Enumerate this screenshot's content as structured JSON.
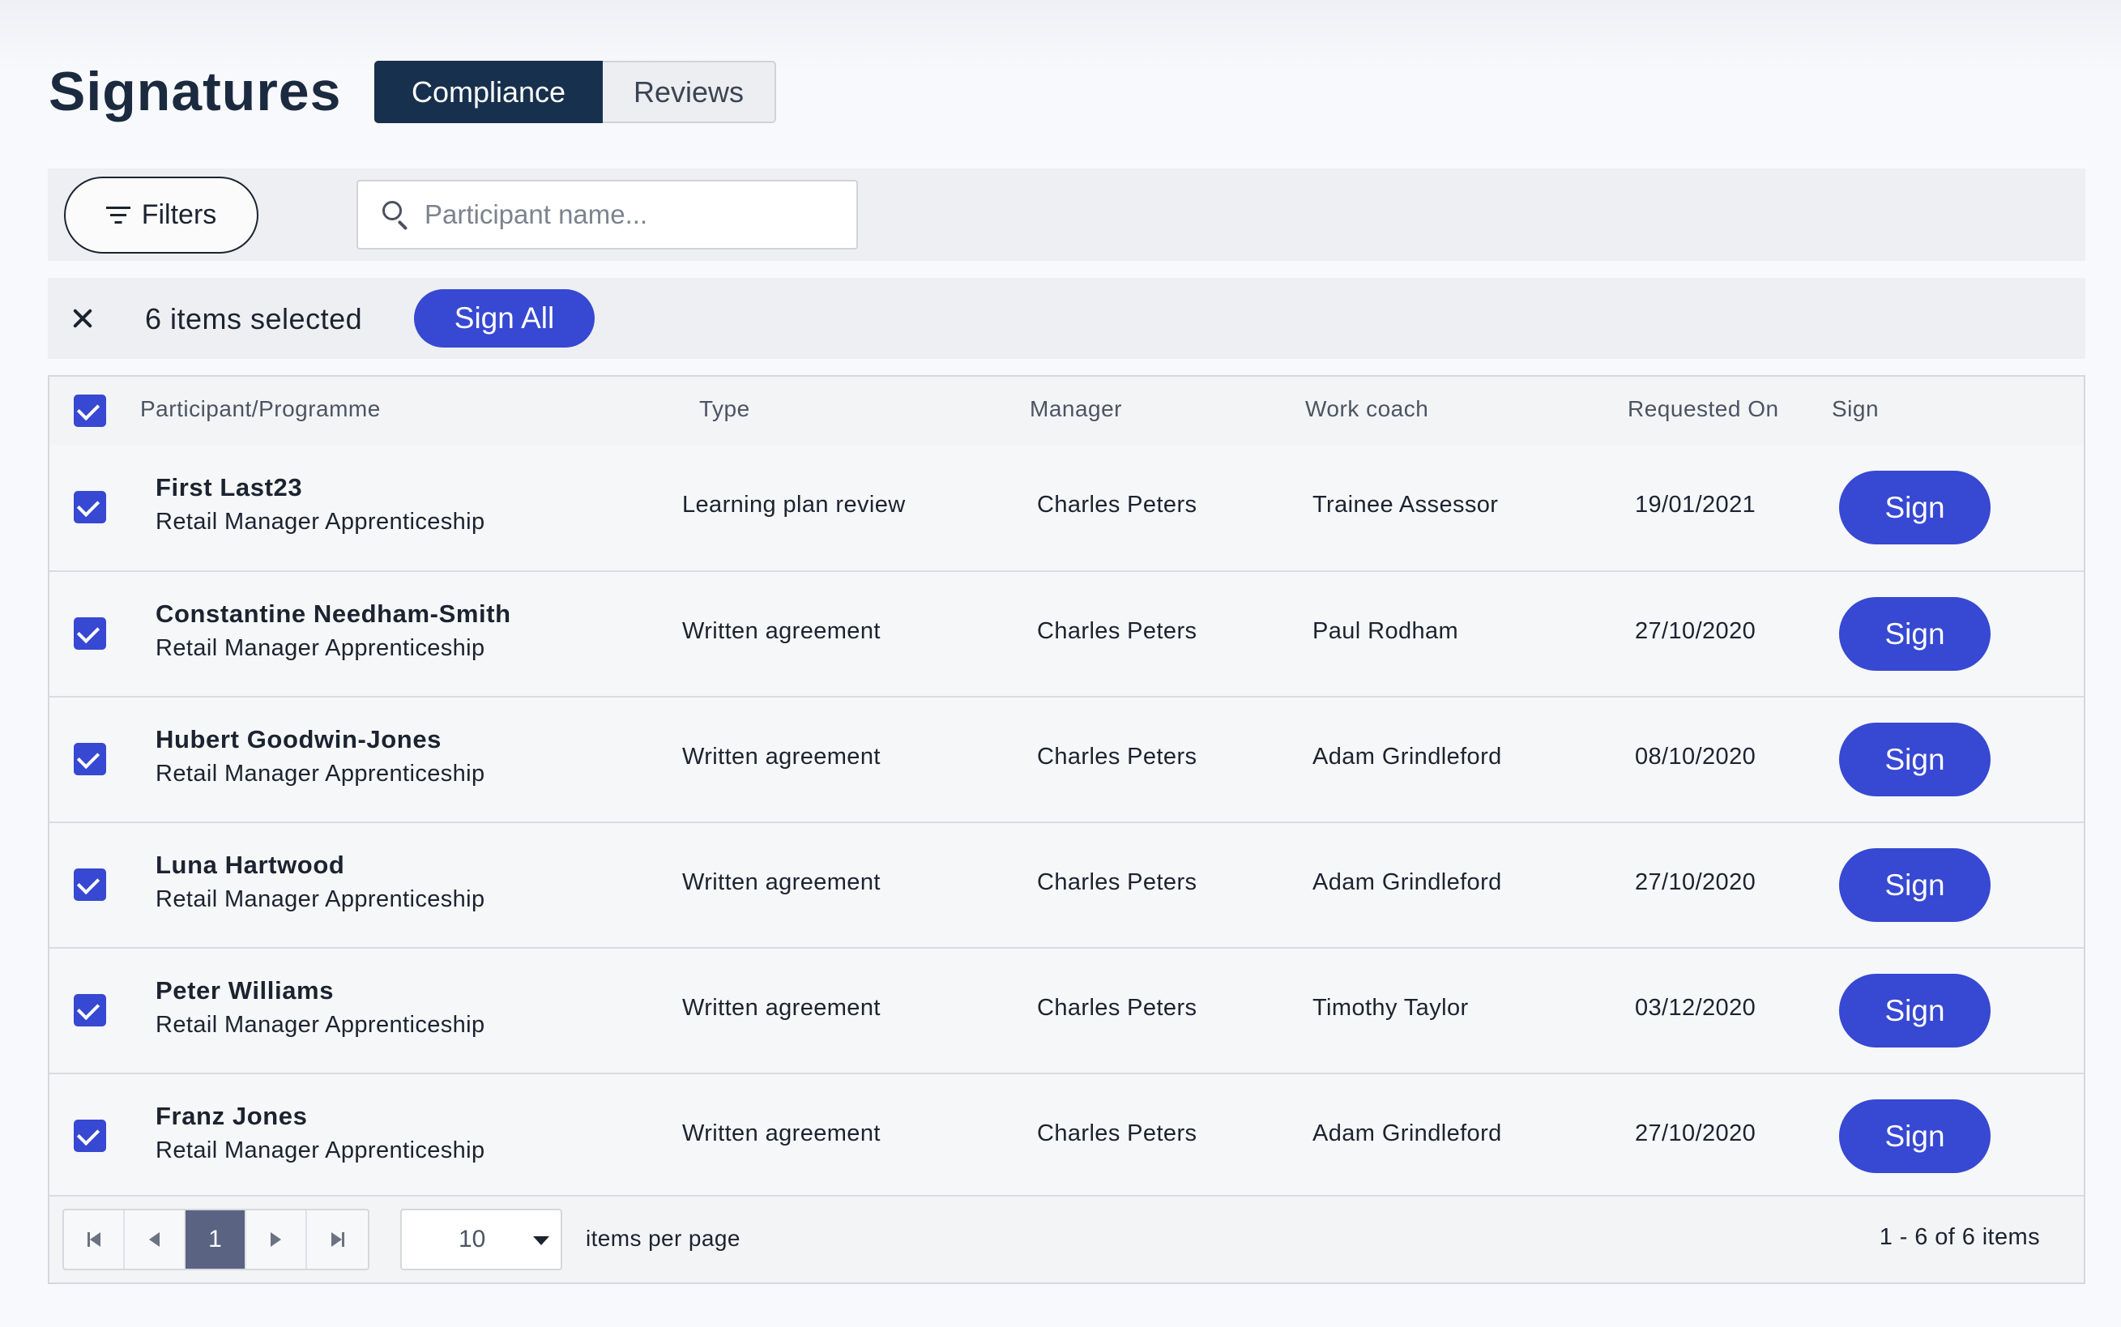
{
  "page": {
    "title": "Signatures"
  },
  "tabs": [
    {
      "label": "Compliance",
      "active": true
    },
    {
      "label": "Reviews",
      "active": false
    }
  ],
  "toolbar": {
    "filters_label": "Filters",
    "search_placeholder": "Participant name..."
  },
  "selection": {
    "count_text": "6 items selected",
    "sign_all_label": "Sign All"
  },
  "table": {
    "columns": [
      "Participant/Programme",
      "Type",
      "Manager",
      "Work coach",
      "Requested On",
      "Sign"
    ],
    "rows": [
      {
        "name": "First Last23",
        "programme": "Retail Manager Apprenticeship",
        "type": "Learning plan review",
        "manager": "Charles Peters",
        "coach": "Trainee Assessor",
        "requested": "19/01/2021",
        "sign": "Sign"
      },
      {
        "name": "Constantine Needham-Smith",
        "programme": "Retail Manager Apprenticeship",
        "type": "Written agreement",
        "manager": "Charles Peters",
        "coach": "Paul Rodham",
        "requested": "27/10/2020",
        "sign": "Sign"
      },
      {
        "name": "Hubert Goodwin-Jones",
        "programme": "Retail Manager Apprenticeship",
        "type": "Written agreement",
        "manager": "Charles Peters",
        "coach": "Adam Grindleford",
        "requested": "08/10/2020",
        "sign": "Sign"
      },
      {
        "name": "Luna Hartwood",
        "programme": "Retail Manager Apprenticeship",
        "type": "Written agreement",
        "manager": "Charles Peters",
        "coach": "Adam Grindleford",
        "requested": "27/10/2020",
        "sign": "Sign"
      },
      {
        "name": "Peter Williams",
        "programme": "Retail Manager Apprenticeship",
        "type": "Written agreement",
        "manager": "Charles Peters",
        "coach": "Timothy Taylor",
        "requested": "03/12/2020",
        "sign": "Sign"
      },
      {
        "name": "Franz Jones",
        "programme": "Retail Manager Apprenticeship",
        "type": "Written agreement",
        "manager": "Charles Peters",
        "coach": "Adam Grindleford",
        "requested": "27/10/2020",
        "sign": "Sign"
      }
    ]
  },
  "pagination": {
    "current_page": "1",
    "page_size": "10",
    "items_per_page_label": "items per page",
    "range_text": "1 - 6 of 6 items"
  },
  "colors": {
    "primary": "#3748d2",
    "active_tab": "#17304d",
    "current_page": "#5a6381"
  }
}
